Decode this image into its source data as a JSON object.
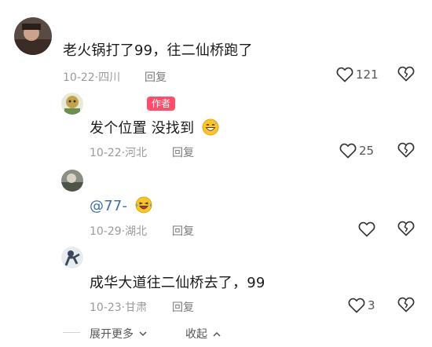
{
  "comments": [
    {
      "author_name": "",
      "content": "老火锅打了99，往二仙桥跑了",
      "date_location": "10-22·四川",
      "reply_label": "回复",
      "like_count": "121"
    },
    {
      "author_name": "",
      "author_badge": "作者",
      "content": "发个位置 没找到",
      "date_location": "10-22·河北",
      "reply_label": "回复",
      "like_count": "25"
    },
    {
      "author_name": "",
      "mention": "@77-",
      "date_location": "10-29·湖北",
      "reply_label": "回复",
      "like_count": ""
    },
    {
      "author_name": "",
      "content": "成华大道往二仙桥去了，99",
      "date_location": "10-23·甘肃",
      "reply_label": "回复",
      "like_count": "3"
    }
  ],
  "footer": {
    "expand_label": "展开更多",
    "collapse_label": "收起"
  },
  "icons": {
    "like": "heart-outline-icon",
    "dislike": "broken-heart-icon",
    "expand": "chevron-down-icon",
    "collapse": "chevron-up-icon"
  },
  "colors": {
    "badge": "#ff4d6a",
    "mention": "#3f6ea8",
    "muted_text": "#9a9a9a"
  }
}
